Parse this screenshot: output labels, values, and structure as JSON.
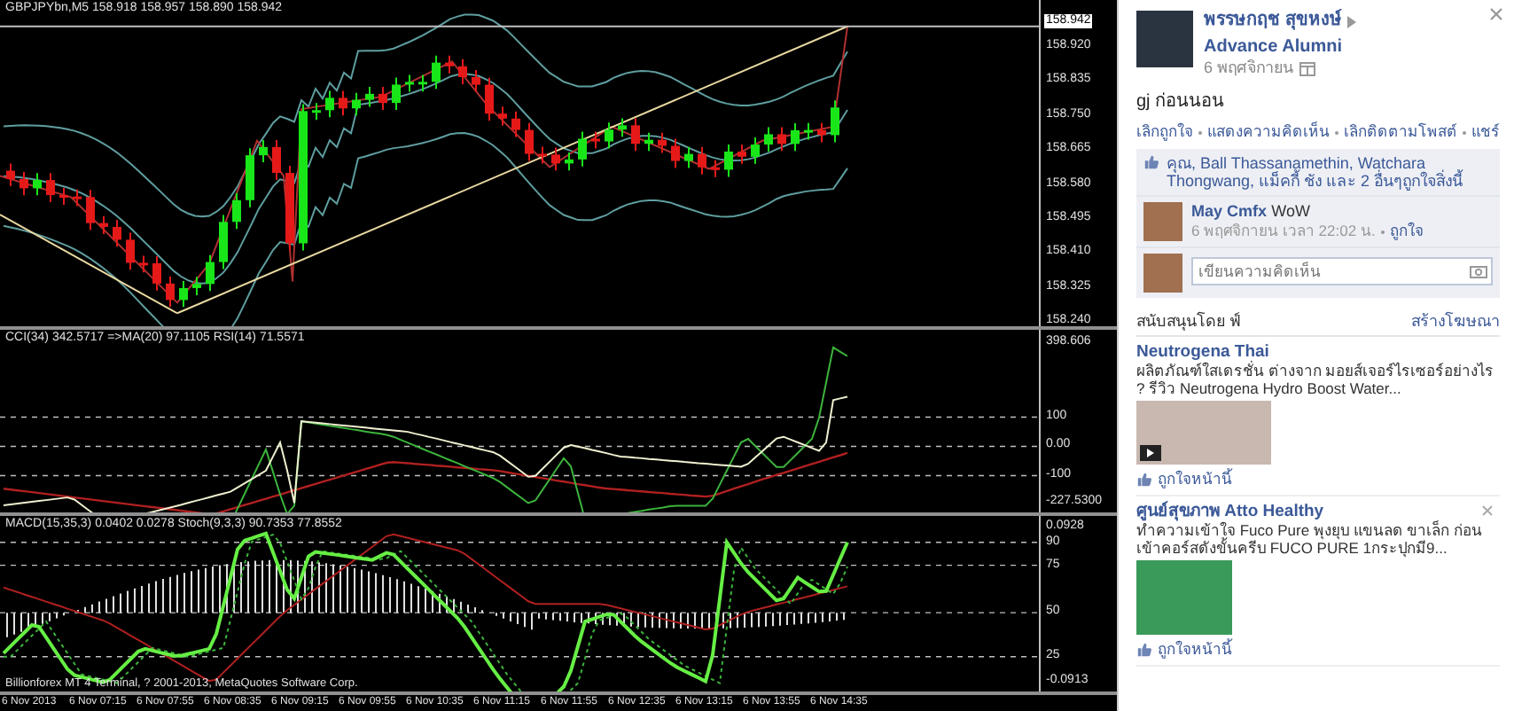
{
  "chart": {
    "title": "GBPJPYbn,M5  158.918 158.957 158.890 158.942",
    "current_price": "158.942",
    "price_axis": [
      "158.920",
      "158.835",
      "158.750",
      "158.665",
      "158.580",
      "158.495",
      "158.410",
      "158.325",
      "158.240"
    ],
    "indicators": [
      {
        "kind": "cci",
        "header": "CCI(34) 342.5717  =>MA(20) 97.1105  RSI(14) 71.5571",
        "axis": [
          "398.606",
          "100",
          "0.00",
          "-100",
          "-227.5300"
        ]
      },
      {
        "kind": "macd",
        "header": "MACD(15,35,3) 0.0402 0.0278  Stoch(9,3,3) 90.7353 77.8552",
        "axis": [
          "0.0928",
          "90",
          "75",
          "50",
          "25",
          "-0.0913"
        ]
      }
    ],
    "copyright": "Billionforex MT 4 Terminal, ? 2001-2013, MetaQuotes Software Corp.",
    "time_axis": [
      "6 Nov 2013",
      "6 Nov 07:15",
      "6 Nov 07:55",
      "6 Nov 08:35",
      "6 Nov 09:15",
      "6 Nov 09:55",
      "6 Nov 10:35",
      "6 Nov 11:15",
      "6 Nov 11:55",
      "6 Nov 12:35",
      "6 Nov 13:15",
      "6 Nov 13:55",
      "6 Nov 14:35"
    ]
  },
  "post": {
    "author": "พรรษกฤช สุขหงษ์",
    "group": "Advance Alumni",
    "date": "6 พฤศจิกายน",
    "text": "gj ก่อนนอน",
    "actions": [
      "เลิกถูกใจ",
      "แสดงความคิดเห็น",
      "เลิกติดตามโพสต์",
      "แชร์"
    ],
    "likes": "คุณ, Ball Thassanamethin, Watchara Thongwang, แม็คกี้ ชัง และ 2 อื่นๆถูกใจสิ่งนี้",
    "comment": {
      "author": "May Cmfx",
      "text": "WoW",
      "time": "6 พฤศจิกายน เวลา 22:02 น.",
      "like": "ถูกใจ"
    },
    "comment_box": {
      "placeholder": "เขียนความคิดเห็น"
    }
  },
  "ads": {
    "heading": "สนับสนุนโดย ฟ์",
    "create": "สร้างโฆษณา",
    "items": [
      {
        "title": "Neutrogena Thai",
        "text": "ผลิตภัณฑ์ใสเดรชั่น ต่างจาก มอยส์เจอร์ไรเซอร์อย่างไร ? รีวิว Neutrogena Hydro Boost Water...",
        "kind": "video",
        "like": "ถูกใจหน้านี้",
        "closable": false
      },
      {
        "title": "ศูนย์สุขภาพ Atto Healthy",
        "text": "ทำความเข้าใจ Fuco Pure พุงยุบ แขนลด ขาเล็ก ก่อน เข้าคอร์สดังขั้นครีบ FUCO PURE 1กระปุกมี9...",
        "kind": "photo",
        "like": "ถูกใจหน้านี้",
        "closable": true
      }
    ]
  }
}
